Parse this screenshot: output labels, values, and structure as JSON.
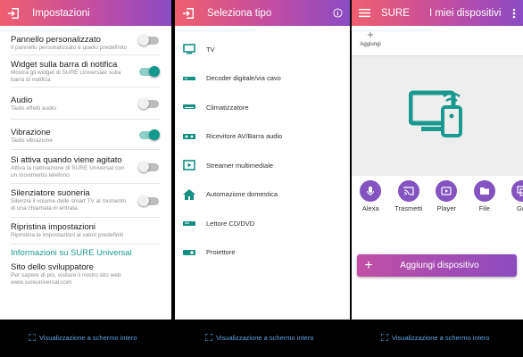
{
  "settings": {
    "title": "Impostazioni",
    "items": [
      {
        "title": "Pannello personalizzato",
        "sub": "Il pannello personalizzato è quello predefinito",
        "toggle": false
      },
      {
        "title": "Widget sulla barra di notifica",
        "sub": "Mostra gli widget di SURE Universale sulla barra di notifica",
        "toggle": true
      },
      {
        "title": "Audio",
        "sub": "Tasto effetti audio",
        "toggle": false
      },
      {
        "title": "Vibrazione",
        "sub": "Tasto vibrazione",
        "toggle": true
      },
      {
        "title": "Si attiva quando viene agitato",
        "sub": "Attiva la riattivazione di SURE Universal con un movimento telefono",
        "toggle": false
      },
      {
        "title": "Silenziatore suoneria",
        "sub": "Silenzia il volume delle smart TV al momento di una chiamata in entrata",
        "toggle": false
      },
      {
        "title": "Ripristina impostazioni",
        "sub": "Ripristina le impostazioni ai valori predefiniti"
      }
    ],
    "section_header": "Informazioni su SURE Universal",
    "developer": {
      "title": "Sito dello sviluppatore",
      "sub": "Per sapere di più, visitare il nostro sito web www.sureuniversal.com"
    }
  },
  "select_type": {
    "title": "Seleziona tipo",
    "items": [
      {
        "label": "TV",
        "icon": "tv-icon"
      },
      {
        "label": "Decoder digitale/via cavo",
        "icon": "decoder-icon"
      },
      {
        "label": "Climatizzatore",
        "icon": "air-conditioner-icon"
      },
      {
        "label": "Ricevitore AV/Barra audio",
        "icon": "av-receiver-icon"
      },
      {
        "label": "Streamer multimediale",
        "icon": "streamer-icon"
      },
      {
        "label": "Automazione domestica",
        "icon": "home-icon"
      },
      {
        "label": "Lettore CD/DVD",
        "icon": "dvd-player-icon"
      },
      {
        "label": "Proiettore",
        "icon": "projector-icon"
      }
    ]
  },
  "devices": {
    "app_name": "SURE",
    "title": "I miei dispositivi",
    "add_label": "Aggiungi",
    "shortcuts": [
      {
        "label": "Alexa",
        "icon": "mic-icon"
      },
      {
        "label": "Trasmetti",
        "icon": "cast-icon"
      },
      {
        "label": "Player",
        "icon": "player-icon"
      },
      {
        "label": "File",
        "icon": "folder-icon"
      },
      {
        "label": "Gru",
        "icon": "group-icon"
      }
    ],
    "add_device_label": "Aggiungi dispositivo"
  },
  "footer": {
    "fullscreen_label": "Visualizzazione a schermo intero"
  },
  "colors": {
    "accent_teal": "#149a8c",
    "header_gradient_start": "#ef5f6e",
    "header_gradient_end": "#8a4bc4",
    "link_blue": "#5da5e6",
    "shortcut_purple": "#8453c0"
  }
}
